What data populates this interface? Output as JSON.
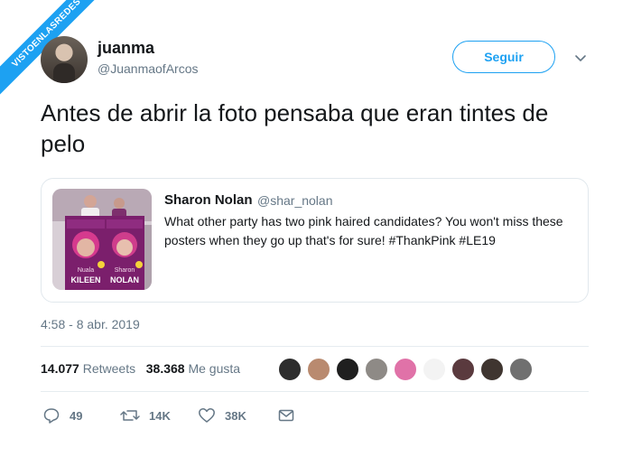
{
  "watermark": "VISTOENLASREDES",
  "author": {
    "name": "juanma",
    "handle": "@JuanmaofArcos",
    "follow_label": "Seguir"
  },
  "tweet": {
    "text": "Antes de abrir la foto pensaba que eran tintes de pelo",
    "timestamp": "4:58 - 8 abr. 2019"
  },
  "quoted": {
    "name": "Sharon Nolan",
    "handle": "@shar_nolan",
    "text": "What other party has two pink haired candidates? You won't miss these posters when they go up that's for sure! #ThankPink #LE19",
    "poster_left_first": "Nuala",
    "poster_left_last": "KILEEN",
    "poster_right_first": "Sharon",
    "poster_right_last": "NOLAN"
  },
  "stats": {
    "retweets_count": "14.077",
    "retweets_label": "Retweets",
    "likes_count": "38.368",
    "likes_label": "Me gusta"
  },
  "actions": {
    "replies": "49",
    "retweets": "14K",
    "likes": "38K"
  },
  "colors": {
    "accent": "#1da1f2",
    "secondary_text": "#657786",
    "border": "#e1e8ed"
  }
}
